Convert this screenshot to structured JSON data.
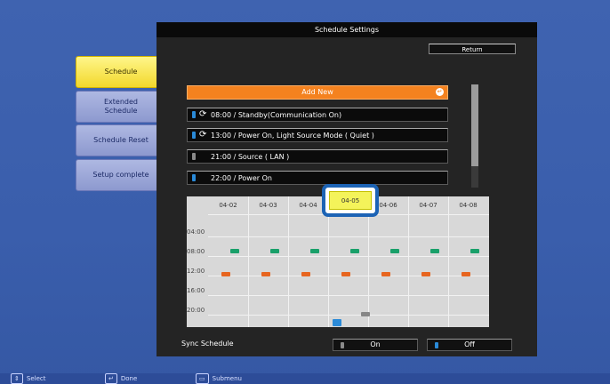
{
  "sidebar": {
    "items": [
      {
        "label": "Schedule",
        "active": true
      },
      {
        "label": "Extended Schedule",
        "active": false
      },
      {
        "label": "Schedule Reset",
        "active": false
      },
      {
        "label": "Setup complete",
        "active": false
      }
    ]
  },
  "panel": {
    "title": "Schedule Settings",
    "return_label": "Return",
    "add_new_label": "Add New",
    "schedule_items": [
      {
        "text": "08:00 / Standby(Communication On)",
        "repeat": true,
        "pin_color": "#2a8ad8"
      },
      {
        "text": "13:00 / Power On, Light Source Mode ( Quiet )",
        "repeat": true,
        "pin_color": "#2a8ad8"
      },
      {
        "text": "21:00 / Source ( LAN )",
        "repeat": false,
        "pin_color": "#8a8a8a"
      },
      {
        "text": "22:00 / Power On",
        "repeat": false,
        "pin_color": "#2a8ad8"
      }
    ]
  },
  "calendar": {
    "dates": [
      "04-02",
      "04-03",
      "04-04",
      "04-05",
      "04-06",
      "04-07",
      "04-08"
    ],
    "selected_date": "04-05",
    "time_labels": [
      "04:00",
      "08:00",
      "12:00",
      "16:00",
      "20:00"
    ]
  },
  "sync": {
    "label": "Sync Schedule",
    "on_label": "On",
    "off_label": "Off",
    "selected": "Off"
  },
  "footer": {
    "select_key": "⇕",
    "select_label": "Select",
    "done_key": "↵",
    "done_label": "Done",
    "submenu_key": "▭",
    "submenu_label": "Submenu"
  },
  "colors": {
    "active_button": "#f2d82c",
    "add_new": "#f4821f",
    "event_green": "#19a06a",
    "event_orange": "#e7651f",
    "highlight_border": "#1c63b5"
  }
}
